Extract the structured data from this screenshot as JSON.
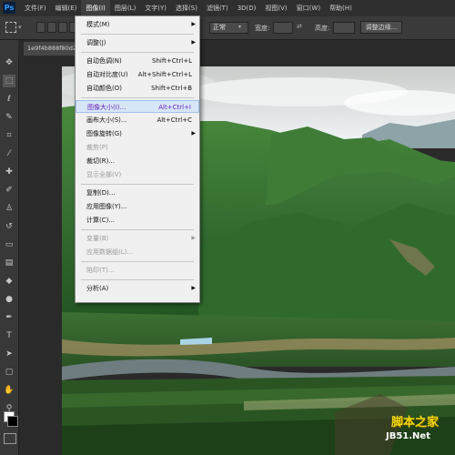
{
  "app": {
    "logo": "Ps"
  },
  "menubar": {
    "items": [
      "文件(F)",
      "编辑(E)",
      "图像(I)",
      "图层(L)",
      "文字(Y)",
      "选择(S)",
      "滤镜(T)",
      "3D(D)",
      "视图(V)",
      "窗口(W)",
      "帮助(H)"
    ],
    "active_index": 2
  },
  "options": {
    "style_value": "正常",
    "width_label": "宽度:",
    "height_label": "高度:",
    "refine_button": "调整边缘..."
  },
  "document_tab": {
    "title": "1e9f4b888f80d261a"
  },
  "image_menu": {
    "items": [
      {
        "label": "模式(M)",
        "shortcut": "",
        "submenu": true,
        "disabled": false
      },
      {
        "type": "separator"
      },
      {
        "label": "调整(J)",
        "shortcut": "",
        "submenu": true,
        "disabled": false
      },
      {
        "type": "separator"
      },
      {
        "label": "自动色调(N)",
        "shortcut": "Shift+Ctrl+L",
        "submenu": false,
        "disabled": false
      },
      {
        "label": "自动对比度(U)",
        "shortcut": "Alt+Shift+Ctrl+L",
        "submenu": false,
        "disabled": false
      },
      {
        "label": "自动颜色(O)",
        "shortcut": "Shift+Ctrl+B",
        "submenu": false,
        "disabled": false
      },
      {
        "type": "separator"
      },
      {
        "label": "图像大小(I)...",
        "shortcut": "Alt+Ctrl+I",
        "submenu": false,
        "disabled": false,
        "highlighted": true
      },
      {
        "label": "画布大小(S)...",
        "shortcut": "Alt+Ctrl+C",
        "submenu": false,
        "disabled": false
      },
      {
        "label": "图像旋转(G)",
        "shortcut": "",
        "submenu": true,
        "disabled": false
      },
      {
        "label": "裁剪(P)",
        "shortcut": "",
        "submenu": false,
        "disabled": true
      },
      {
        "label": "裁切(R)...",
        "shortcut": "",
        "submenu": false,
        "disabled": false
      },
      {
        "label": "显示全部(V)",
        "shortcut": "",
        "submenu": false,
        "disabled": true
      },
      {
        "type": "separator"
      },
      {
        "label": "复制(D)...",
        "shortcut": "",
        "submenu": false,
        "disabled": false
      },
      {
        "label": "应用图像(Y)...",
        "shortcut": "",
        "submenu": false,
        "disabled": false
      },
      {
        "label": "计算(C)...",
        "shortcut": "",
        "submenu": false,
        "disabled": false
      },
      {
        "type": "separator"
      },
      {
        "label": "变量(B)",
        "shortcut": "",
        "submenu": true,
        "disabled": true
      },
      {
        "label": "应用数据组(L)...",
        "shortcut": "",
        "submenu": false,
        "disabled": true
      },
      {
        "type": "separator"
      },
      {
        "label": "陷印(T)...",
        "shortcut": "",
        "submenu": false,
        "disabled": true
      },
      {
        "type": "separator"
      },
      {
        "label": "分析(A)",
        "shortcut": "",
        "submenu": true,
        "disabled": false
      }
    ]
  },
  "tools": [
    "move-icon",
    "marquee-icon",
    "lasso-icon",
    "quick-select-icon",
    "crop-icon",
    "eyedropper-icon",
    "healing-icon",
    "brush-icon",
    "clone-stamp-icon",
    "history-brush-icon",
    "eraser-icon",
    "gradient-icon",
    "blur-icon",
    "dodge-icon",
    "pen-icon",
    "type-icon",
    "path-select-icon",
    "shape-icon",
    "hand-icon",
    "zoom-icon"
  ],
  "watermark": {
    "line1": "脚本之家",
    "line2": "JB51.Net"
  },
  "colors": {
    "accent_highlight": "#6a1fb8",
    "menu_bg": "#f0f0f0",
    "ui_dark": "#3b3b3b"
  }
}
